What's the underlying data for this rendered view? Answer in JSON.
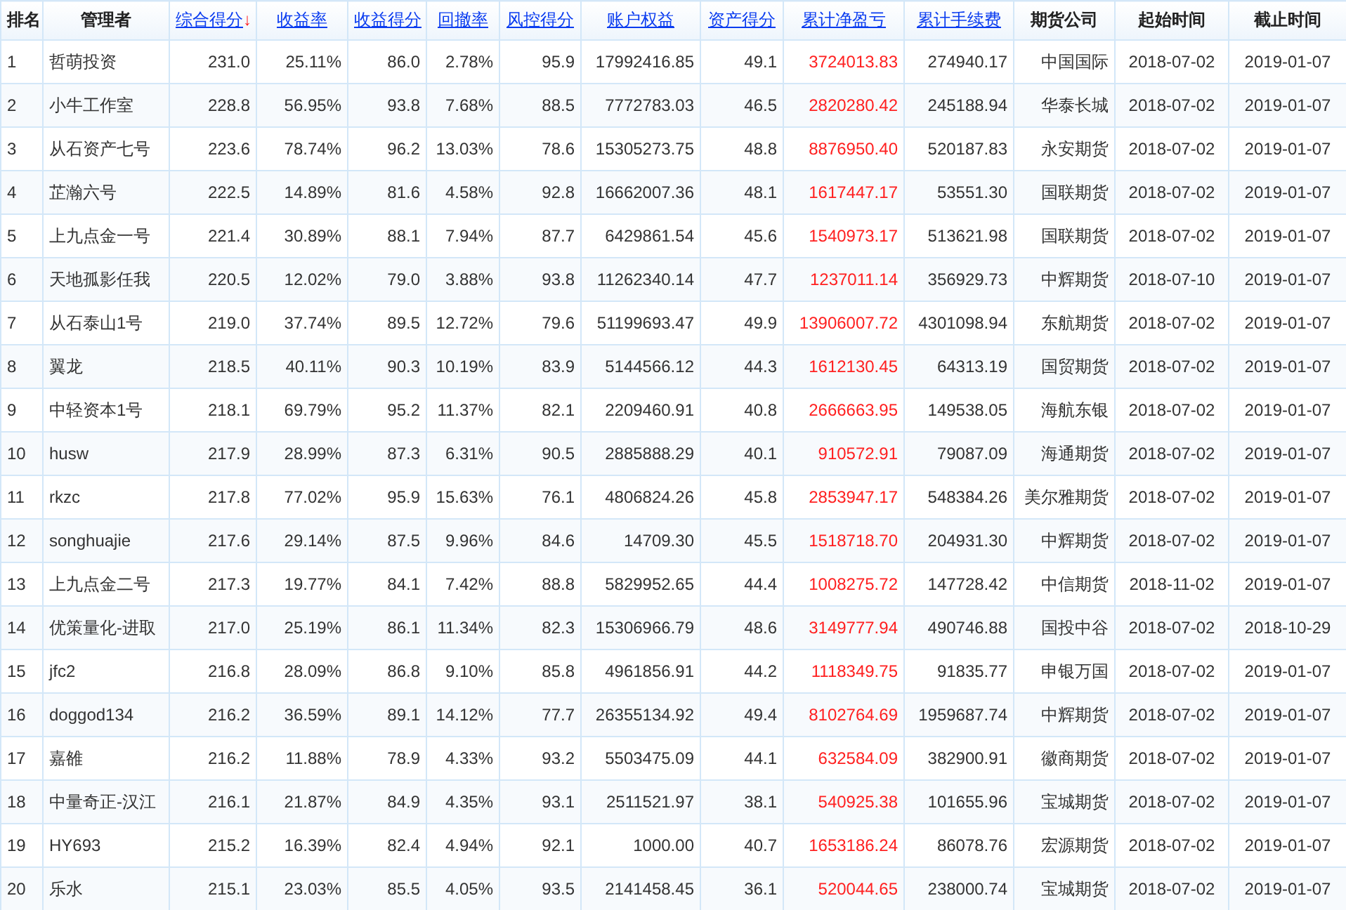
{
  "table": {
    "columns": [
      {
        "label": "排名",
        "kind": "plain"
      },
      {
        "label": "管理者",
        "kind": "plain"
      },
      {
        "label": "综合得分",
        "kind": "link",
        "sort_indicator": "↓"
      },
      {
        "label": "收益率",
        "kind": "link"
      },
      {
        "label": "收益得分",
        "kind": "link"
      },
      {
        "label": "回撤率",
        "kind": "link"
      },
      {
        "label": "风控得分",
        "kind": "link"
      },
      {
        "label": "账户权益",
        "kind": "link"
      },
      {
        "label": "资产得分",
        "kind": "link"
      },
      {
        "label": "累计净盈亏",
        "kind": "link"
      },
      {
        "label": "累计手续费",
        "kind": "link"
      },
      {
        "label": "期货公司",
        "kind": "plain"
      },
      {
        "label": "起始时间",
        "kind": "plain"
      },
      {
        "label": "截止时间",
        "kind": "plain"
      }
    ],
    "rows": [
      [
        "1",
        "哲萌投资",
        "231.0",
        "25.11%",
        "86.0",
        "2.78%",
        "95.9",
        "17992416.85",
        "49.1",
        "3724013.83",
        "274940.17",
        "中国国际",
        "2018-07-02",
        "2019-01-07"
      ],
      [
        "2",
        "小牛工作室",
        "228.8",
        "56.95%",
        "93.8",
        "7.68%",
        "88.5",
        "7772783.03",
        "46.5",
        "2820280.42",
        "245188.94",
        "华泰长城",
        "2018-07-02",
        "2019-01-07"
      ],
      [
        "3",
        "从石资产七号",
        "223.6",
        "78.74%",
        "96.2",
        "13.03%",
        "78.6",
        "15305273.75",
        "48.8",
        "8876950.40",
        "520187.83",
        "永安期货",
        "2018-07-02",
        "2019-01-07"
      ],
      [
        "4",
        "芷瀚六号",
        "222.5",
        "14.89%",
        "81.6",
        "4.58%",
        "92.8",
        "16662007.36",
        "48.1",
        "1617447.17",
        "53551.30",
        "国联期货",
        "2018-07-02",
        "2019-01-07"
      ],
      [
        "5",
        "上九点金一号",
        "221.4",
        "30.89%",
        "88.1",
        "7.94%",
        "87.7",
        "6429861.54",
        "45.6",
        "1540973.17",
        "513621.98",
        "国联期货",
        "2018-07-02",
        "2019-01-07"
      ],
      [
        "6",
        "天地孤影任我",
        "220.5",
        "12.02%",
        "79.0",
        "3.88%",
        "93.8",
        "11262340.14",
        "47.7",
        "1237011.14",
        "356929.73",
        "中辉期货",
        "2018-07-10",
        "2019-01-07"
      ],
      [
        "7",
        "从石泰山1号",
        "219.0",
        "37.74%",
        "89.5",
        "12.72%",
        "79.6",
        "51199693.47",
        "49.9",
        "13906007.72",
        "4301098.94",
        "东航期货",
        "2018-07-02",
        "2019-01-07"
      ],
      [
        "8",
        "翼龙",
        "218.5",
        "40.11%",
        "90.3",
        "10.19%",
        "83.9",
        "5144566.12",
        "44.3",
        "1612130.45",
        "64313.19",
        "国贸期货",
        "2018-07-02",
        "2019-01-07"
      ],
      [
        "9",
        "中轻资本1号",
        "218.1",
        "69.79%",
        "95.2",
        "11.37%",
        "82.1",
        "2209460.91",
        "40.8",
        "2666663.95",
        "149538.05",
        "海航东银",
        "2018-07-02",
        "2019-01-07"
      ],
      [
        "10",
        "husw",
        "217.9",
        "28.99%",
        "87.3",
        "6.31%",
        "90.5",
        "2885888.29",
        "40.1",
        "910572.91",
        "79087.09",
        "海通期货",
        "2018-07-02",
        "2019-01-07"
      ],
      [
        "11",
        "rkzc",
        "217.8",
        "77.02%",
        "95.9",
        "15.63%",
        "76.1",
        "4806824.26",
        "45.8",
        "2853947.17",
        "548384.26",
        "美尔雅期货",
        "2018-07-02",
        "2019-01-07"
      ],
      [
        "12",
        "songhuajie",
        "217.6",
        "29.14%",
        "87.5",
        "9.96%",
        "84.6",
        "14709.30",
        "45.5",
        "1518718.70",
        "204931.30",
        "中辉期货",
        "2018-07-02",
        "2019-01-07"
      ],
      [
        "13",
        "上九点金二号",
        "217.3",
        "19.77%",
        "84.1",
        "7.42%",
        "88.8",
        "5829952.65",
        "44.4",
        "1008275.72",
        "147728.42",
        "中信期货",
        "2018-11-02",
        "2019-01-07"
      ],
      [
        "14",
        "优策量化-进取",
        "217.0",
        "25.19%",
        "86.1",
        "11.34%",
        "82.3",
        "15306966.79",
        "48.6",
        "3149777.94",
        "490746.88",
        "国投中谷",
        "2018-07-02",
        "2018-10-29"
      ],
      [
        "15",
        "jfc2",
        "216.8",
        "28.09%",
        "86.8",
        "9.10%",
        "85.8",
        "4961856.91",
        "44.2",
        "1118349.75",
        "91835.77",
        "申银万国",
        "2018-07-02",
        "2019-01-07"
      ],
      [
        "16",
        "doggod134",
        "216.2",
        "36.59%",
        "89.1",
        "14.12%",
        "77.7",
        "26355134.92",
        "49.4",
        "8102764.69",
        "1959687.74",
        "中辉期货",
        "2018-07-02",
        "2019-01-07"
      ],
      [
        "17",
        "嘉雒",
        "216.2",
        "11.88%",
        "78.9",
        "4.33%",
        "93.2",
        "5503475.09",
        "44.1",
        "632584.09",
        "382900.91",
        "徽商期货",
        "2018-07-02",
        "2019-01-07"
      ],
      [
        "18",
        "中量奇正-汉江",
        "216.1",
        "21.87%",
        "84.9",
        "4.35%",
        "93.1",
        "2511521.97",
        "38.1",
        "540925.38",
        "101655.96",
        "宝城期货",
        "2018-07-02",
        "2019-01-07"
      ],
      [
        "19",
        "HY693",
        "215.2",
        "16.39%",
        "82.4",
        "4.94%",
        "92.1",
        "1000.00",
        "40.7",
        "1653186.24",
        "86078.76",
        "宏源期货",
        "2018-07-02",
        "2019-01-07"
      ],
      [
        "20",
        "乐水",
        "215.1",
        "23.03%",
        "85.5",
        "4.05%",
        "93.5",
        "2141458.45",
        "36.1",
        "520044.65",
        "238000.74",
        "宝城期货",
        "2018-07-02",
        "2019-01-07"
      ]
    ]
  }
}
